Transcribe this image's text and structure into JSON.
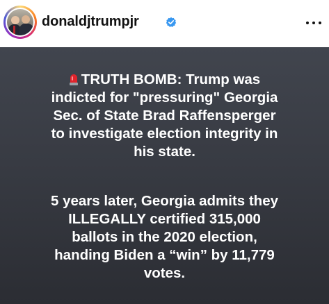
{
  "header": {
    "username": "donaldjtrumpjr",
    "verified_icon": "verified-badge-icon",
    "more_icon": "more-options-icon",
    "verified_color": "#3797f0"
  },
  "post": {
    "background_color": "#383b43",
    "text_color": "#ffffff",
    "paragraph1": {
      "emoji_icon": "siren-emoji-icon",
      "lines": [
        "TRUTH BOMB: Trump was",
        "indicted for \"pressuring\" Georgia",
        "Sec. of State Brad Raffensperger",
        "to investigate election integrity in",
        "his state."
      ]
    },
    "paragraph2": {
      "lines": [
        "5 years later, Georgia admits they",
        "ILLEGALLY certified 315,000",
        "ballots in the 2020 election,",
        "handing Biden a “win” by 11,779",
        "votes."
      ]
    }
  }
}
